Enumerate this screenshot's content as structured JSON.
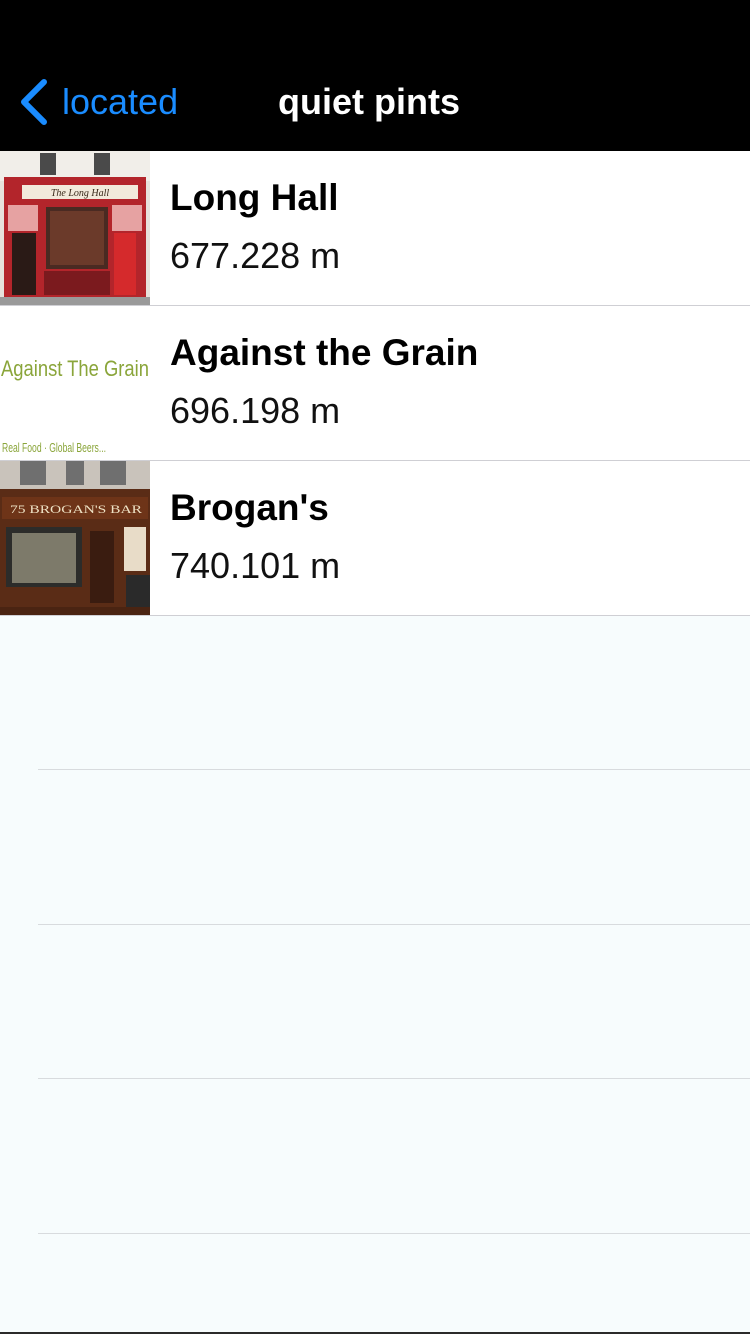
{
  "nav": {
    "back_label": "located",
    "title": "quiet pints"
  },
  "pubs": [
    {
      "name": "Long Hall",
      "distance": "677.228 m",
      "sign": "The Long Hall"
    },
    {
      "name": "Against the Grain",
      "distance": "696.198 m",
      "logo_main": "Against The Grain",
      "logo_sub": "Real Food · Global Beers..."
    },
    {
      "name": "Brogan's",
      "distance": "740.101 m",
      "sign": "75   BROGAN'S BAR"
    }
  ],
  "colors": {
    "nav_bg": "#000000",
    "accent": "#1a8cff",
    "list_bg": "#f7fcfd"
  }
}
